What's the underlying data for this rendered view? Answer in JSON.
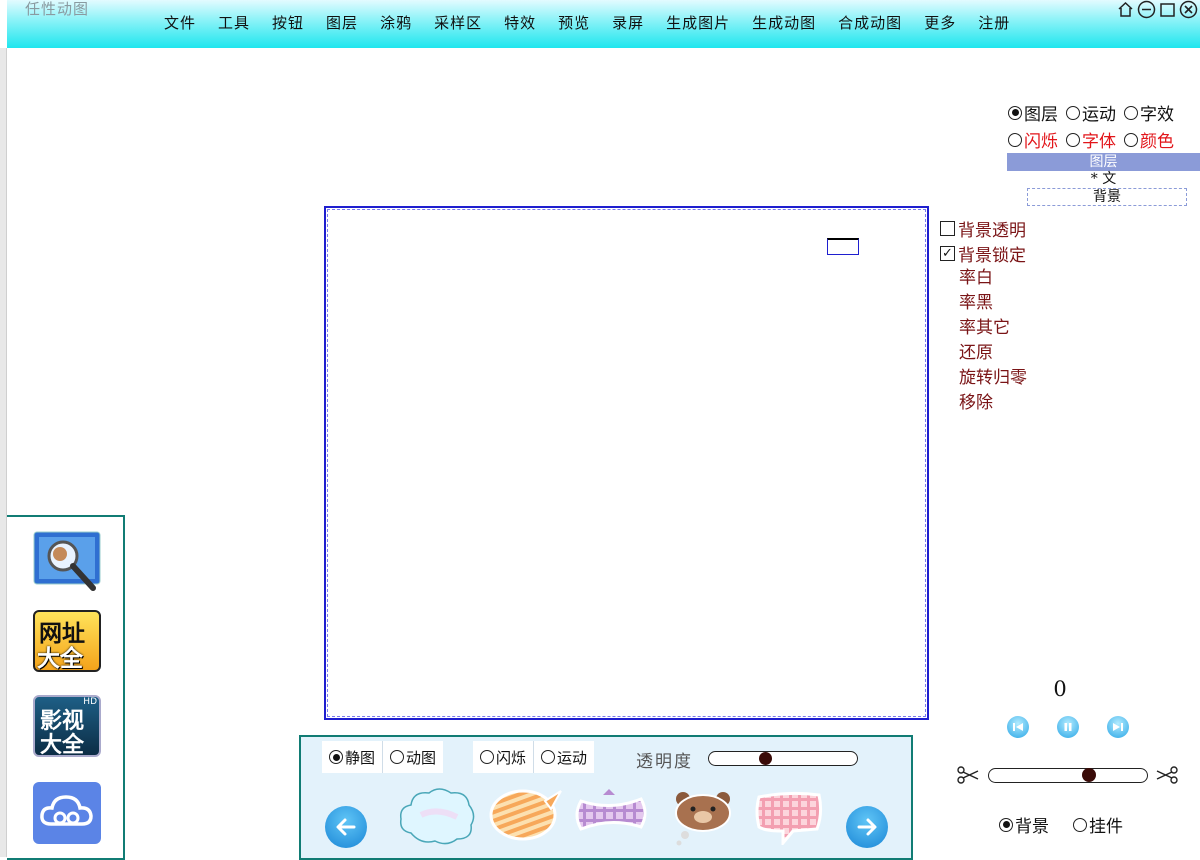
{
  "app_title": "任性动图",
  "menu": [
    "文件",
    "工具",
    "按钮",
    "图层",
    "涂鸦",
    "采样区",
    "特效",
    "预览",
    "录屏",
    "生成图片",
    "生成动图",
    "合成动图",
    "更多",
    "注册"
  ],
  "window_controls": [
    "home-icon",
    "minimize-icon",
    "maximize-icon",
    "close-icon"
  ],
  "sidebar_apps": [
    {
      "name": "magnifier-search-app-icon"
    },
    {
      "name": "网址大全",
      "icon": "web-directory-app-icon"
    },
    {
      "name": "影视大全",
      "icon": "video-app-icon"
    },
    {
      "name": "cloud-app-icon"
    }
  ],
  "sidebar_text": {
    "app2": "网址",
    "app2b": "大全",
    "app3": "影视",
    "app3b": "大全",
    "app3_badge": "HD"
  },
  "layer_panel": {
    "row1": [
      {
        "label": "图层",
        "checked": true
      },
      {
        "label": "运动",
        "checked": false
      },
      {
        "label": "字效",
        "checked": false
      }
    ],
    "row2": [
      {
        "label": "闪烁",
        "checked": false
      },
      {
        "label": "字体",
        "checked": false
      },
      {
        "label": "颜色",
        "checked": false
      }
    ],
    "header": "图层",
    "item1": "* 文",
    "item2": "背景"
  },
  "background_options": {
    "transparent": {
      "label": "背景透明",
      "checked": false
    },
    "locked": {
      "label": "背景锁定",
      "checked": true
    },
    "actions": [
      "率白",
      "率黑",
      "率其它",
      "还原",
      "旋转归零",
      "移除"
    ]
  },
  "frame_counter": "0",
  "playback": [
    "rewind-icon",
    "pause-icon",
    "fast-forward-icon"
  ],
  "cut_slider": {
    "value": 0.72
  },
  "layer_type": [
    {
      "label": "背景",
      "checked": true
    },
    {
      "label": "挂件",
      "checked": false
    }
  ],
  "bottom_panel": {
    "static_dynamic": [
      {
        "label": "静图",
        "checked": true
      },
      {
        "label": "动图",
        "checked": false
      }
    ],
    "effects": [
      {
        "label": "闪烁",
        "checked": false
      },
      {
        "label": "运动",
        "checked": false
      }
    ],
    "opacity_label": "透明度",
    "opacity_value": 0.37,
    "bubbles": [
      "cloud-bubble",
      "orange-striped-bubble",
      "purple-plaid-bubble",
      "bear-bubble",
      "pink-plaid-bubble"
    ]
  }
}
